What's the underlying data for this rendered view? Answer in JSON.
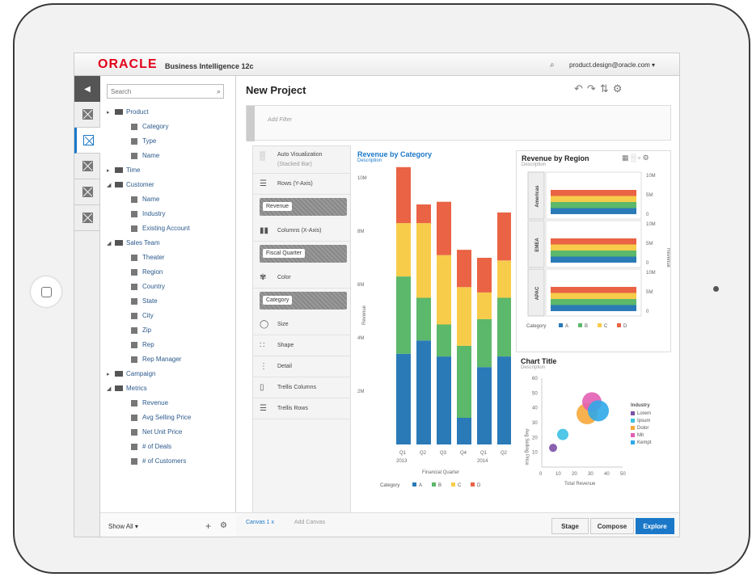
{
  "app": {
    "brand": "ORACLE",
    "product": "Business Intelligence 12c",
    "user": "product.design@oracle.com ▾"
  },
  "data_panel": {
    "search_placeholder": "Search",
    "tree": [
      {
        "type": "folder",
        "label": "Product",
        "arrow": "▸"
      },
      {
        "type": "leaf",
        "label": "Category"
      },
      {
        "type": "leaf",
        "label": "Type"
      },
      {
        "type": "leaf",
        "label": "Name"
      },
      {
        "type": "folder",
        "label": "Time",
        "arrow": "▸"
      },
      {
        "type": "folder",
        "label": "Customer",
        "arrow": "◢"
      },
      {
        "type": "leaf",
        "label": "Name"
      },
      {
        "type": "leaf",
        "label": "Industry"
      },
      {
        "type": "leaf",
        "label": "Existing Account"
      },
      {
        "type": "folder",
        "label": "Sales Team",
        "arrow": "◢"
      },
      {
        "type": "leaf",
        "label": "Theater"
      },
      {
        "type": "leaf",
        "label": "Region"
      },
      {
        "type": "leaf",
        "label": "Country"
      },
      {
        "type": "leaf",
        "label": "State"
      },
      {
        "type": "leaf",
        "label": "City"
      },
      {
        "type": "leaf",
        "label": "Zip"
      },
      {
        "type": "leaf",
        "label": "Rep"
      },
      {
        "type": "leaf",
        "label": "Rep Manager"
      },
      {
        "type": "folder",
        "label": "Campaign",
        "arrow": "▸"
      },
      {
        "type": "folder",
        "label": "Metrics",
        "arrow": "◢"
      },
      {
        "type": "leaf",
        "label": "Revenue"
      },
      {
        "type": "leaf",
        "label": "Avg Selling Price"
      },
      {
        "type": "leaf",
        "label": "Net Unit Price"
      },
      {
        "type": "leaf",
        "label": "# of Deals"
      },
      {
        "type": "leaf",
        "label": "# of Customers"
      }
    ],
    "show_all": "Show All ▾"
  },
  "project": {
    "title": "New Project",
    "add_filter": "Add Filter"
  },
  "grammar": {
    "viz_type": "Auto Visualization",
    "viz_sub": "(Stacked Bar)",
    "rows_label": "Rows (Y-Axis)",
    "rows_pill": "Revenue",
    "columns_label": "Columns (X-Axis)",
    "columns_pill": "Fiscal Quarter",
    "color_label": "Color",
    "color_pill": "Category",
    "size_label": "Size",
    "shape_label": "Shape",
    "detail_label": "Detail",
    "trellis_columns": "Trellis Columns",
    "trellis_rows": "Trellis Rows"
  },
  "colors": {
    "A": "#2a7ab8",
    "B": "#5cb86a",
    "C": "#f7cc4a",
    "D": "#ea6345",
    "accent": "#1b78c8"
  },
  "chart_data": [
    {
      "type": "bar",
      "title": "Revenue by Category",
      "subtitle": "Description",
      "xlabel": "Financial Quarter",
      "ylabel": "Revenue",
      "ylim": [
        0,
        10
      ],
      "y_ticks": [
        "10M",
        "8M",
        "6M",
        "4M",
        "2M"
      ],
      "categories": [
        "Q1",
        "Q2",
        "Q3",
        "Q4",
        "Q1",
        "Q2"
      ],
      "years": [
        "2013",
        "2014"
      ],
      "series": [
        {
          "name": "A",
          "values": [
            3.4,
            3.9,
            3.3,
            1.0,
            2.9,
            3.3
          ]
        },
        {
          "name": "B",
          "values": [
            2.9,
            1.6,
            1.2,
            2.7,
            1.8,
            2.2
          ]
        },
        {
          "name": "C",
          "values": [
            2.0,
            2.8,
            2.6,
            2.2,
            1.0,
            1.4
          ]
        },
        {
          "name": "D",
          "values": [
            2.1,
            0.7,
            2.0,
            1.4,
            1.3,
            1.8
          ]
        }
      ],
      "legend_title": "Category",
      "legend_position": "bottom"
    },
    {
      "type": "bar",
      "title": "Revenue by Region",
      "subtitle": "Description",
      "ylabel": "Revenue",
      "rows": [
        "Americas",
        "EMEA",
        "APAC"
      ],
      "y_ticks": [
        "10M",
        "5M",
        "0"
      ],
      "series": [
        {
          "name": "A",
          "values": [
            2.5,
            2.5,
            2.5
          ]
        },
        {
          "name": "B",
          "values": [
            2.5,
            2.5,
            2.5
          ]
        },
        {
          "name": "C",
          "values": [
            2.5,
            2.5,
            2.5
          ]
        },
        {
          "name": "D",
          "values": [
            2.5,
            2.5,
            2.5
          ]
        }
      ],
      "legend_title": "Category",
      "legend_position": "bottom"
    },
    {
      "type": "scatter",
      "title": "Chart Title",
      "subtitle": "Description",
      "xlabel": "Total Revenue",
      "ylabel": "Avg Selling Price",
      "xlim": [
        0,
        50
      ],
      "ylim": [
        0,
        60
      ],
      "x_ticks": [
        "0",
        "10",
        "20",
        "30",
        "40",
        "50"
      ],
      "y_ticks": [
        "60",
        "50",
        "40",
        "30",
        "20",
        "10"
      ],
      "legend_title": "Industry",
      "legend_position": "right",
      "series": [
        {
          "name": "Lorem",
          "color": "#7d4fa6",
          "x": 7,
          "y": 13,
          "size": 5
        },
        {
          "name": "Ipsum",
          "color": "#3dc1e4",
          "x": 13,
          "y": 22,
          "size": 7
        },
        {
          "name": "Dolor",
          "color": "#f6a93b",
          "x": 28,
          "y": 36,
          "size": 13
        },
        {
          "name": "Mit",
          "color": "#e25fb3",
          "x": 31,
          "y": 44,
          "size": 12
        },
        {
          "name": "Kempt",
          "color": "#2fa8e8",
          "x": 35,
          "y": 38,
          "size": 13
        }
      ]
    }
  ],
  "footer": {
    "canvas_tab": "Canvas 1  x",
    "add_canvas": "Add Canvas",
    "stage": "Stage",
    "compose": "Compose",
    "explore": "Explore"
  }
}
